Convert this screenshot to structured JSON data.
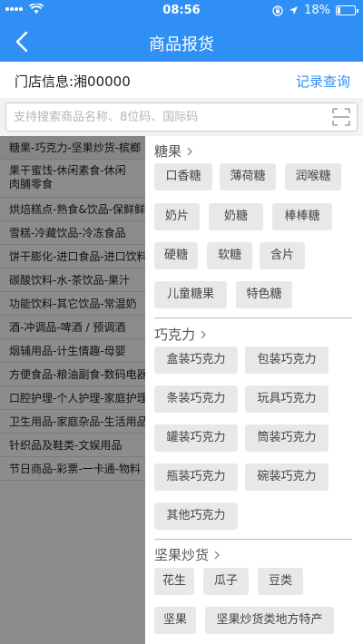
{
  "status": {
    "time": "08:56",
    "battery": "18%",
    "battery_level": 0.18
  },
  "nav": {
    "title": "商品报货"
  },
  "store": {
    "label": "门店信息:湘00000",
    "record_link": "记录查询"
  },
  "search": {
    "placeholder": "支持搜索商品名称、8位码、国际码",
    "value": ""
  },
  "categories": [
    "糖果-巧克力-坚果炒货-槟榔",
    "果干蜜饯-休闲素食-休闲肉脯零食",
    "烘焙糕点-熟食&饮品-保鲜鲜食",
    "雪糕-冷藏饮品-冷冻食品",
    "饼干膨化-进口食品-进口饮料",
    "碳酸饮料-水-茶饮品-果汁",
    "功能饮料-其它饮品-常温奶",
    "酒-冲调品-啤酒 / 预调酒",
    "烟辅用品-计生情趣-母婴",
    "方便食品-粮油副食-数码电器",
    "口腔护理-个人护理-家庭护理",
    "卫生用品-家庭杂品-生活用品",
    "针织品及鞋类-文娱用品",
    "节日商品-彩票-一卡通-物料"
  ],
  "sections": [
    {
      "title": "糖果",
      "tags": [
        "口香糖",
        "薄荷糖",
        "润喉糖",
        "奶片",
        "奶糖",
        "棒棒糖",
        "硬糖",
        "软糖",
        "含片",
        "儿童糖果",
        "特色糖"
      ]
    },
    {
      "title": "巧克力",
      "tags": [
        "盒装巧克力",
        "包装巧克力",
        "条装巧克力",
        "玩具巧克力",
        "罐装巧克力",
        "筒装巧克力",
        "瓶装巧克力",
        "碗装巧克力",
        "其他巧克力"
      ]
    },
    {
      "title": "坚果炒货",
      "tags": [
        "花生",
        "瓜子",
        "豆类",
        "坚果",
        "坚果炒货类地方特产"
      ]
    }
  ],
  "colors": {
    "accent": "#2f8ff5"
  }
}
